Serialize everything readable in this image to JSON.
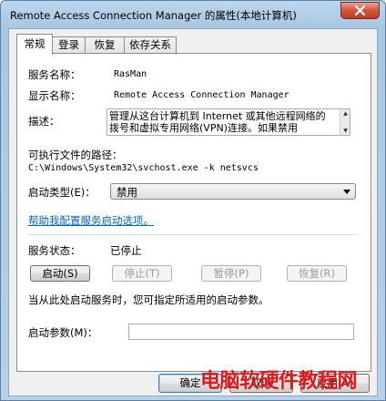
{
  "window": {
    "title": "Remote Access Connection Manager 的属性(本地计算机)"
  },
  "tabs": [
    {
      "label": "常规"
    },
    {
      "label": "登录"
    },
    {
      "label": "恢复"
    },
    {
      "label": "依存关系"
    }
  ],
  "general": {
    "service_name_label": "服务名称：",
    "service_name_value": "RasMan",
    "display_name_label": "显示名称：",
    "display_name_value": "Remote Access Connection Manager",
    "description_label": "描述：",
    "description_value": "管理从这台计算机到 Internet 或其他远程网络的拨号和虚拟专用网络(VPN)连接。如果禁用",
    "exe_path_label": "可执行文件的路径：",
    "exe_path_value": "C:\\Windows\\System32\\svchost.exe -k netsvcs",
    "startup_type_label": "启动类型(E)：",
    "startup_type_value": "禁用",
    "help_link": "帮助我配置服务启动选项。",
    "service_status_label": "服务状态：",
    "service_status_value": "已停止",
    "start_btn": "启动(S)",
    "stop_btn": "停止(T)",
    "pause_btn": "暂停(P)",
    "resume_btn": "恢复(R)",
    "hint_text": "当从此处启动服务时，您可指定所适用的启动参数。",
    "start_params_label": "启动参数(M)：",
    "start_params_value": ""
  },
  "footer": {
    "ok_btn": "确定",
    "cancel_btn": "取消",
    "apply_btn": "应用(A)"
  },
  "watermark": "电脑软硬件教程网",
  "colors": {
    "link": "#0066cc",
    "close_button": "#c23a20",
    "watermark": "#e1191b"
  }
}
